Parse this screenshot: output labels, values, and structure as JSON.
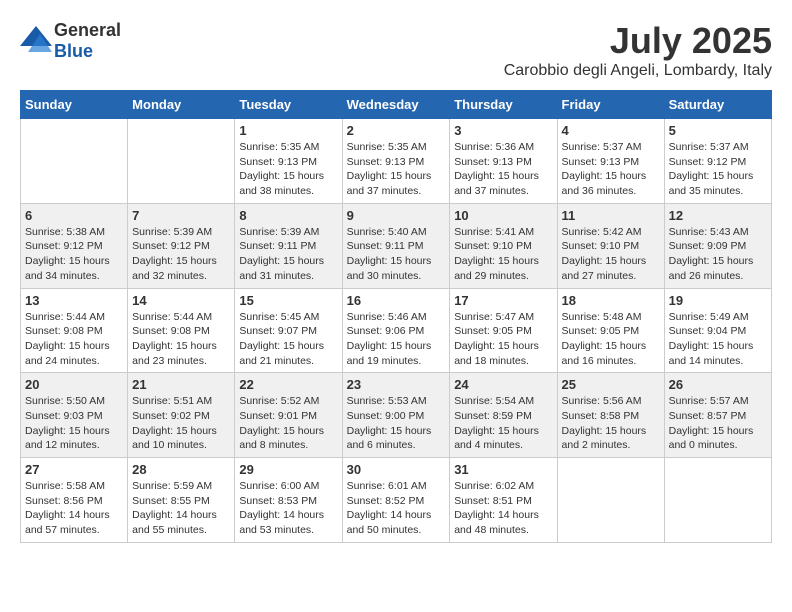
{
  "header": {
    "logo_general": "General",
    "logo_blue": "Blue",
    "month_year": "July 2025",
    "location": "Carobbio degli Angeli, Lombardy, Italy"
  },
  "columns": [
    "Sunday",
    "Monday",
    "Tuesday",
    "Wednesday",
    "Thursday",
    "Friday",
    "Saturday"
  ],
  "weeks": [
    [
      {
        "day": "",
        "info": ""
      },
      {
        "day": "",
        "info": ""
      },
      {
        "day": "1",
        "info": "Sunrise: 5:35 AM\nSunset: 9:13 PM\nDaylight: 15 hours and 38 minutes."
      },
      {
        "day": "2",
        "info": "Sunrise: 5:35 AM\nSunset: 9:13 PM\nDaylight: 15 hours and 37 minutes."
      },
      {
        "day": "3",
        "info": "Sunrise: 5:36 AM\nSunset: 9:13 PM\nDaylight: 15 hours and 37 minutes."
      },
      {
        "day": "4",
        "info": "Sunrise: 5:37 AM\nSunset: 9:13 PM\nDaylight: 15 hours and 36 minutes."
      },
      {
        "day": "5",
        "info": "Sunrise: 5:37 AM\nSunset: 9:12 PM\nDaylight: 15 hours and 35 minutes."
      }
    ],
    [
      {
        "day": "6",
        "info": "Sunrise: 5:38 AM\nSunset: 9:12 PM\nDaylight: 15 hours and 34 minutes."
      },
      {
        "day": "7",
        "info": "Sunrise: 5:39 AM\nSunset: 9:12 PM\nDaylight: 15 hours and 32 minutes."
      },
      {
        "day": "8",
        "info": "Sunrise: 5:39 AM\nSunset: 9:11 PM\nDaylight: 15 hours and 31 minutes."
      },
      {
        "day": "9",
        "info": "Sunrise: 5:40 AM\nSunset: 9:11 PM\nDaylight: 15 hours and 30 minutes."
      },
      {
        "day": "10",
        "info": "Sunrise: 5:41 AM\nSunset: 9:10 PM\nDaylight: 15 hours and 29 minutes."
      },
      {
        "day": "11",
        "info": "Sunrise: 5:42 AM\nSunset: 9:10 PM\nDaylight: 15 hours and 27 minutes."
      },
      {
        "day": "12",
        "info": "Sunrise: 5:43 AM\nSunset: 9:09 PM\nDaylight: 15 hours and 26 minutes."
      }
    ],
    [
      {
        "day": "13",
        "info": "Sunrise: 5:44 AM\nSunset: 9:08 PM\nDaylight: 15 hours and 24 minutes."
      },
      {
        "day": "14",
        "info": "Sunrise: 5:44 AM\nSunset: 9:08 PM\nDaylight: 15 hours and 23 minutes."
      },
      {
        "day": "15",
        "info": "Sunrise: 5:45 AM\nSunset: 9:07 PM\nDaylight: 15 hours and 21 minutes."
      },
      {
        "day": "16",
        "info": "Sunrise: 5:46 AM\nSunset: 9:06 PM\nDaylight: 15 hours and 19 minutes."
      },
      {
        "day": "17",
        "info": "Sunrise: 5:47 AM\nSunset: 9:05 PM\nDaylight: 15 hours and 18 minutes."
      },
      {
        "day": "18",
        "info": "Sunrise: 5:48 AM\nSunset: 9:05 PM\nDaylight: 15 hours and 16 minutes."
      },
      {
        "day": "19",
        "info": "Sunrise: 5:49 AM\nSunset: 9:04 PM\nDaylight: 15 hours and 14 minutes."
      }
    ],
    [
      {
        "day": "20",
        "info": "Sunrise: 5:50 AM\nSunset: 9:03 PM\nDaylight: 15 hours and 12 minutes."
      },
      {
        "day": "21",
        "info": "Sunrise: 5:51 AM\nSunset: 9:02 PM\nDaylight: 15 hours and 10 minutes."
      },
      {
        "day": "22",
        "info": "Sunrise: 5:52 AM\nSunset: 9:01 PM\nDaylight: 15 hours and 8 minutes."
      },
      {
        "day": "23",
        "info": "Sunrise: 5:53 AM\nSunset: 9:00 PM\nDaylight: 15 hours and 6 minutes."
      },
      {
        "day": "24",
        "info": "Sunrise: 5:54 AM\nSunset: 8:59 PM\nDaylight: 15 hours and 4 minutes."
      },
      {
        "day": "25",
        "info": "Sunrise: 5:56 AM\nSunset: 8:58 PM\nDaylight: 15 hours and 2 minutes."
      },
      {
        "day": "26",
        "info": "Sunrise: 5:57 AM\nSunset: 8:57 PM\nDaylight: 15 hours and 0 minutes."
      }
    ],
    [
      {
        "day": "27",
        "info": "Sunrise: 5:58 AM\nSunset: 8:56 PM\nDaylight: 14 hours and 57 minutes."
      },
      {
        "day": "28",
        "info": "Sunrise: 5:59 AM\nSunset: 8:55 PM\nDaylight: 14 hours and 55 minutes."
      },
      {
        "day": "29",
        "info": "Sunrise: 6:00 AM\nSunset: 8:53 PM\nDaylight: 14 hours and 53 minutes."
      },
      {
        "day": "30",
        "info": "Sunrise: 6:01 AM\nSunset: 8:52 PM\nDaylight: 14 hours and 50 minutes."
      },
      {
        "day": "31",
        "info": "Sunrise: 6:02 AM\nSunset: 8:51 PM\nDaylight: 14 hours and 48 minutes."
      },
      {
        "day": "",
        "info": ""
      },
      {
        "day": "",
        "info": ""
      }
    ]
  ]
}
